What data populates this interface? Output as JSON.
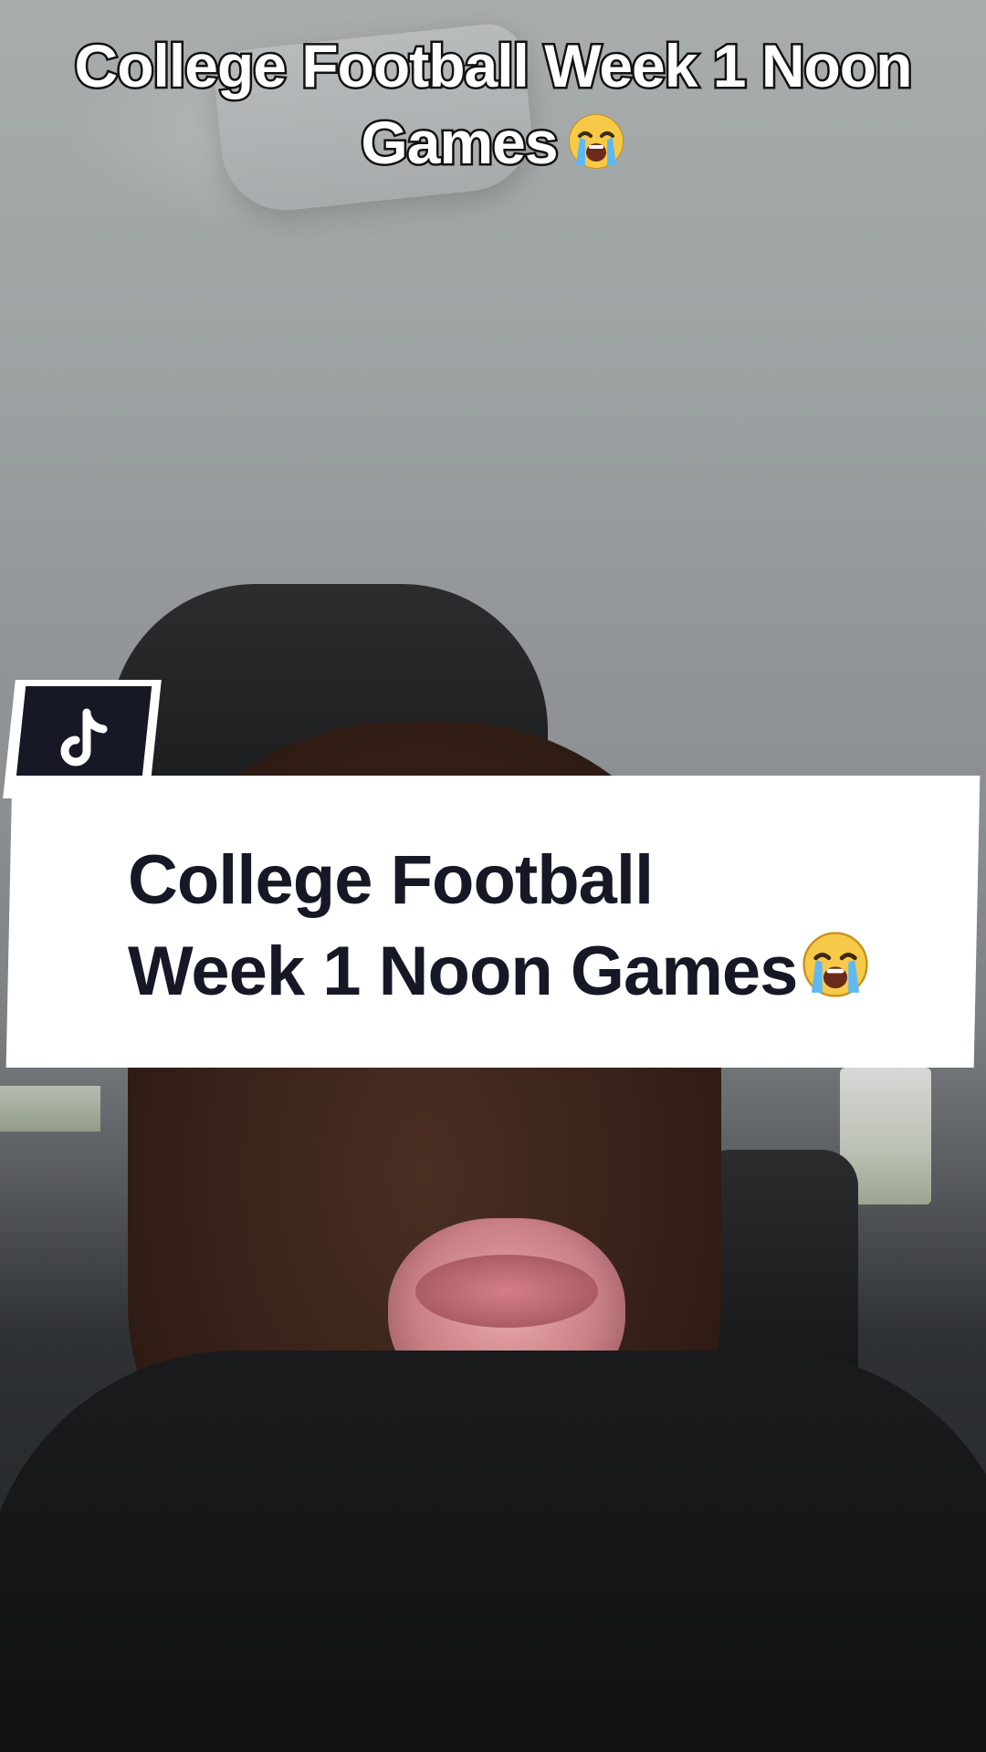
{
  "caption": {
    "line1": "College Football Week 1 Noon",
    "line2": "Games",
    "emoji": "loudly-crying-face-emoji"
  },
  "title_card": {
    "line1": "College Football",
    "line2": "Week 1 Noon Games",
    "emoji": "loudly-crying-face-emoji",
    "logo": "tiktok-logo-icon",
    "text_color": "#171826",
    "card_color": "#ffffff"
  }
}
